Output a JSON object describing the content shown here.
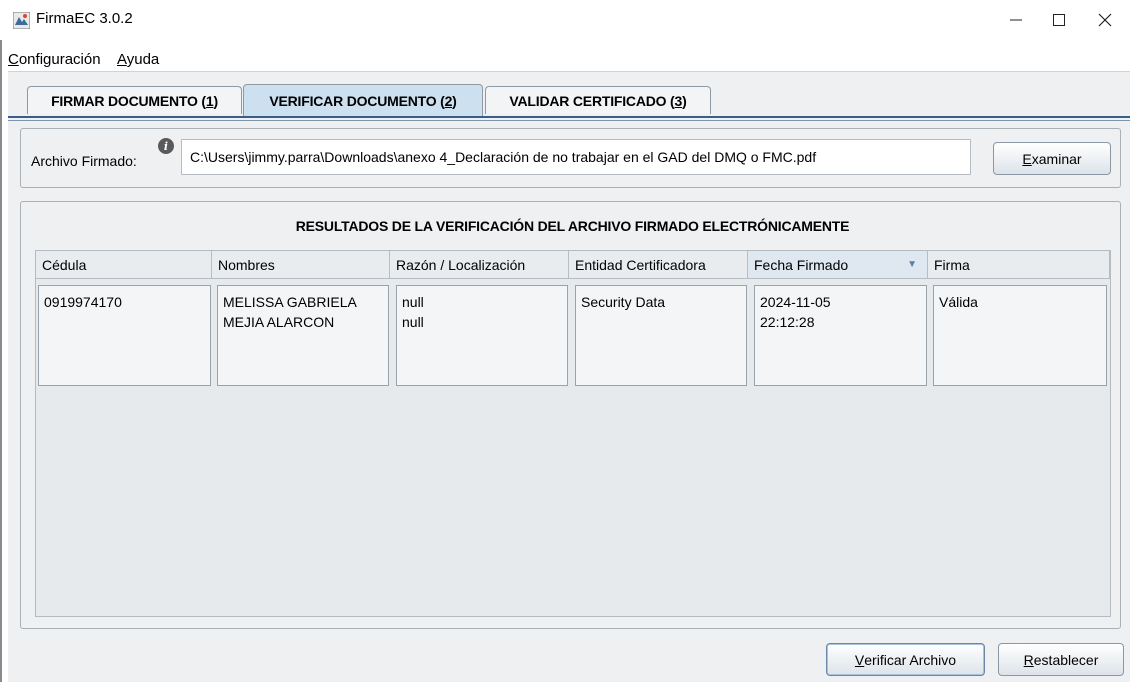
{
  "window": {
    "title": "FirmaEC 3.0.2"
  },
  "menu": [
    {
      "pre": "",
      "key": "C",
      "post": "onfiguración"
    },
    {
      "pre": "",
      "key": "A",
      "post": "yuda"
    }
  ],
  "tabs": [
    {
      "label": "FIRMAR DOCUMENTO (",
      "key": "1",
      "end": ")"
    },
    {
      "label": "VERIFICAR DOCUMENTO (",
      "key": "2",
      "end": ")"
    },
    {
      "label": "VALIDAR CERTIFICADO (",
      "key": "3",
      "end": ")"
    }
  ],
  "file": {
    "label": "Archivo Firmado:",
    "value": "C:\\Users\\jimmy.parra\\Downloads\\anexo 4_Declaración de no trabajar en el GAD del DMQ o FMC.pdf",
    "browse_key": "E",
    "browse_rest": "xaminar"
  },
  "results": {
    "title": "RESULTADOS DE LA VERIFICACIÓN DEL ARCHIVO FIRMADO ELECTRÓNICAMENTE",
    "columns": [
      "Cédula",
      "Nombres",
      "Razón / Localización",
      "Entidad Certificadora",
      "Fecha Firmado",
      "Firma"
    ],
    "rows": [
      {
        "cedula": "0919974170",
        "nombres": [
          "MELISSA GABRIELA",
          "MEJIA ALARCON"
        ],
        "razon": [
          "null",
          "null"
        ],
        "entidad": "Security Data",
        "fecha": [
          "2024-11-05",
          "22:12:28"
        ],
        "firma": "Válida"
      }
    ]
  },
  "buttons": {
    "verify_key": "V",
    "verify_rest": "erificar Archivo",
    "reset_key": "R",
    "reset_rest": "establecer"
  }
}
